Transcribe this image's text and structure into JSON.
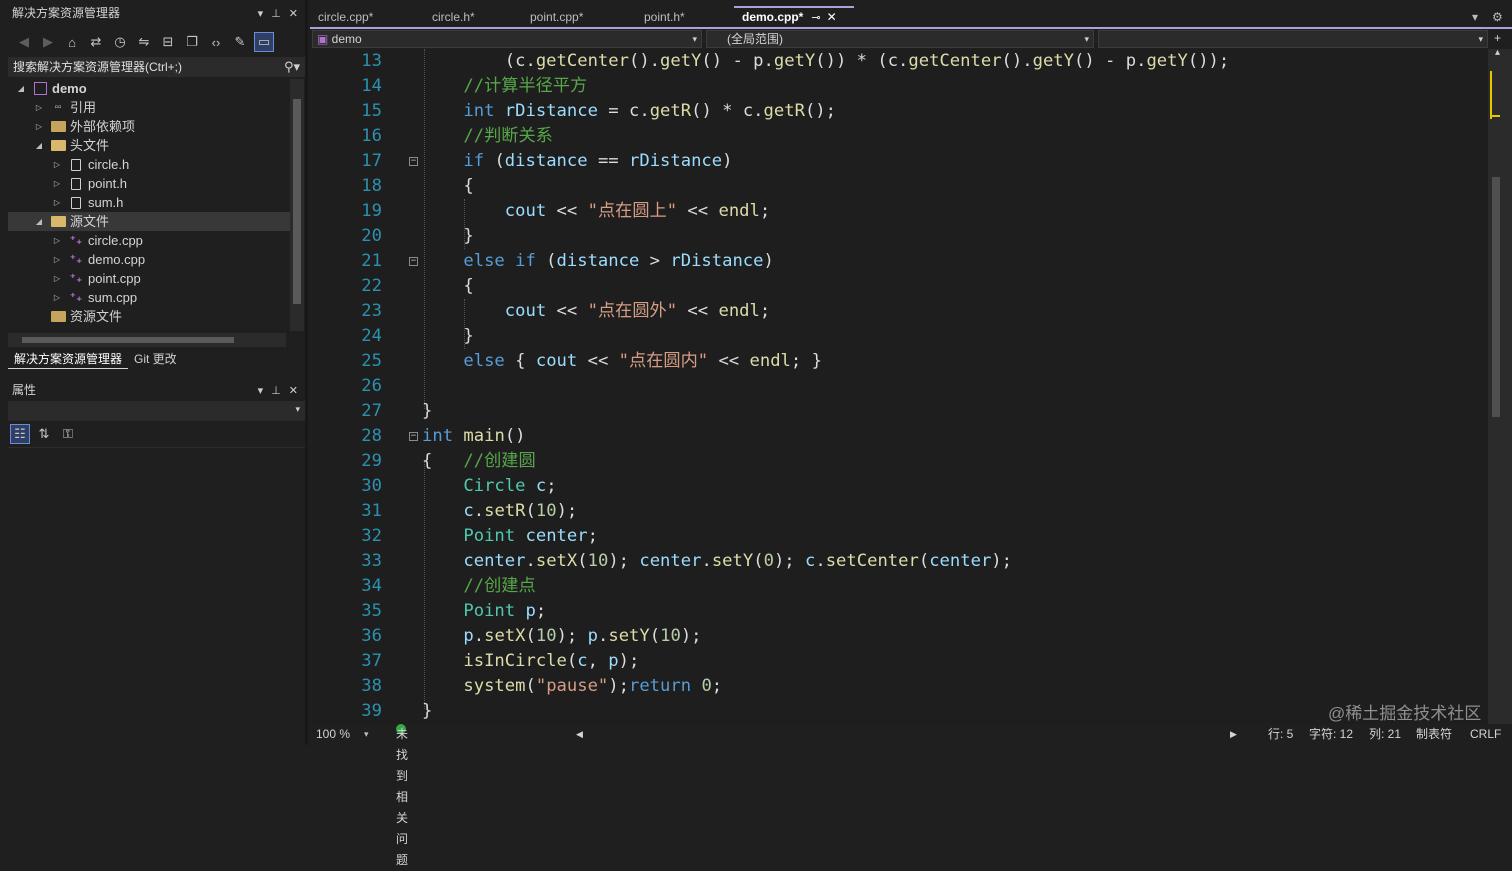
{
  "solution_explorer": {
    "title": "解决方案资源管理器",
    "search_placeholder": "搜索解决方案资源管理器(Ctrl+;)",
    "tree": [
      {
        "label": "demo",
        "icon": "project-icon",
        "level": 0,
        "expanded": true,
        "bold": true
      },
      {
        "label": "引用",
        "icon": "references-icon",
        "level": 1,
        "expanded": false
      },
      {
        "label": "外部依赖项",
        "icon": "folder-icon",
        "level": 1,
        "expanded": false
      },
      {
        "label": "头文件",
        "icon": "folder-open-icon",
        "level": 1,
        "expanded": true
      },
      {
        "label": "circle.h",
        "icon": "header-file-icon",
        "level": 2,
        "expanded": false
      },
      {
        "label": "point.h",
        "icon": "header-file-icon",
        "level": 2,
        "expanded": false
      },
      {
        "label": "sum.h",
        "icon": "header-file-icon",
        "level": 2,
        "expanded": false
      },
      {
        "label": "源文件",
        "icon": "folder-open-icon",
        "level": 1,
        "expanded": true,
        "selected": true
      },
      {
        "label": "circle.cpp",
        "icon": "cpp-file-icon",
        "level": 2,
        "expanded": false
      },
      {
        "label": "demo.cpp",
        "icon": "cpp-file-icon",
        "level": 2,
        "expanded": false
      },
      {
        "label": "point.cpp",
        "icon": "cpp-file-icon",
        "level": 2,
        "expanded": false
      },
      {
        "label": "sum.cpp",
        "icon": "cpp-file-icon",
        "level": 2,
        "expanded": false
      },
      {
        "label": "资源文件",
        "icon": "folder-icon",
        "level": 1,
        "leaf": true
      }
    ],
    "bottom_tabs": [
      "解决方案资源管理器",
      "Git 更改"
    ]
  },
  "properties": {
    "title": "属性"
  },
  "editor": {
    "tabs": [
      {
        "label": "circle.cpp*",
        "active": false
      },
      {
        "label": "circle.h*",
        "active": false
      },
      {
        "label": "point.cpp*",
        "active": false
      },
      {
        "label": "point.h*",
        "active": false
      },
      {
        "label": "demo.cpp*",
        "active": true
      }
    ],
    "nav_project": "demo",
    "nav_scope": "(全局范围)",
    "lines": [
      {
        "n": "13",
        "fold": false,
        "tokens": [
          [
            "pl",
            "        (c."
          ],
          [
            "fn",
            "getCenter"
          ],
          [
            "pl",
            "()."
          ],
          [
            "fn",
            "getY"
          ],
          [
            "pl",
            "() - p."
          ],
          [
            "fn",
            "getY"
          ],
          [
            "pl",
            "()) * (c."
          ],
          [
            "fn",
            "getCenter"
          ],
          [
            "pl",
            "()."
          ],
          [
            "fn",
            "getY"
          ],
          [
            "pl",
            "() - p."
          ],
          [
            "fn",
            "getY"
          ],
          [
            "pl",
            "());"
          ]
        ]
      },
      {
        "n": "14",
        "fold": false,
        "tokens": [
          [
            "cm",
            "    //计算半径平方"
          ]
        ]
      },
      {
        "n": "15",
        "fold": false,
        "tokens": [
          [
            "kw",
            "    int"
          ],
          [
            "pl",
            " "
          ],
          [
            "vr",
            "rDistance"
          ],
          [
            "pl",
            " = c."
          ],
          [
            "fn",
            "getR"
          ],
          [
            "pl",
            "() * c."
          ],
          [
            "fn",
            "getR"
          ],
          [
            "pl",
            "();"
          ]
        ]
      },
      {
        "n": "16",
        "fold": false,
        "tokens": [
          [
            "cm",
            "    //判断关系"
          ]
        ]
      },
      {
        "n": "17",
        "fold": true,
        "tokens": [
          [
            "kw",
            "    if"
          ],
          [
            "pl",
            " ("
          ],
          [
            "vr",
            "distance"
          ],
          [
            "pl",
            " == "
          ],
          [
            "vr",
            "rDistance"
          ],
          [
            "pl",
            ")"
          ]
        ]
      },
      {
        "n": "18",
        "fold": false,
        "tokens": [
          [
            "pl",
            "    {"
          ]
        ]
      },
      {
        "n": "19",
        "fold": false,
        "tokens": [
          [
            "pl",
            "        "
          ],
          [
            "vr",
            "cout"
          ],
          [
            "pl",
            " << "
          ],
          [
            "st",
            "\"点在圆上\""
          ],
          [
            "pl",
            " << "
          ],
          [
            "fn",
            "endl"
          ],
          [
            "pl",
            ";"
          ]
        ]
      },
      {
        "n": "20",
        "fold": false,
        "tokens": [
          [
            "pl",
            "    }"
          ]
        ]
      },
      {
        "n": "21",
        "fold": true,
        "tokens": [
          [
            "kw",
            "    else if"
          ],
          [
            "pl",
            " ("
          ],
          [
            "vr",
            "distance"
          ],
          [
            "pl",
            " > "
          ],
          [
            "vr",
            "rDistance"
          ],
          [
            "pl",
            ")"
          ]
        ]
      },
      {
        "n": "22",
        "fold": false,
        "tokens": [
          [
            "pl",
            "    {"
          ]
        ]
      },
      {
        "n": "23",
        "fold": false,
        "tokens": [
          [
            "pl",
            "        "
          ],
          [
            "vr",
            "cout"
          ],
          [
            "pl",
            " << "
          ],
          [
            "st",
            "\"点在圆外\""
          ],
          [
            "pl",
            " << "
          ],
          [
            "fn",
            "endl"
          ],
          [
            "pl",
            ";"
          ]
        ]
      },
      {
        "n": "24",
        "fold": false,
        "tokens": [
          [
            "pl",
            "    }"
          ]
        ]
      },
      {
        "n": "25",
        "fold": false,
        "tokens": [
          [
            "kw",
            "    else"
          ],
          [
            "pl",
            " { "
          ],
          [
            "vr",
            "cout"
          ],
          [
            "pl",
            " << "
          ],
          [
            "st",
            "\"点在圆内\""
          ],
          [
            "pl",
            " << "
          ],
          [
            "fn",
            "endl"
          ],
          [
            "pl",
            "; }"
          ]
        ]
      },
      {
        "n": "26",
        "fold": false,
        "tokens": []
      },
      {
        "n": "27",
        "fold": false,
        "tokens": [
          [
            "pl",
            "}"
          ]
        ]
      },
      {
        "n": "28",
        "fold": true,
        "tokens": [
          [
            "kw",
            "int"
          ],
          [
            "pl",
            " "
          ],
          [
            "fn",
            "main"
          ],
          [
            "pl",
            "()"
          ]
        ]
      },
      {
        "n": "29",
        "fold": false,
        "tokens": [
          [
            "pl",
            "{   "
          ],
          [
            "cm",
            "//创建圆"
          ]
        ]
      },
      {
        "n": "30",
        "fold": false,
        "tokens": [
          [
            "ty",
            "    Circle"
          ],
          [
            "pl",
            " "
          ],
          [
            "vr",
            "c"
          ],
          [
            "pl",
            ";"
          ]
        ]
      },
      {
        "n": "31",
        "fold": false,
        "tokens": [
          [
            "vr",
            "    c"
          ],
          [
            "pl",
            "."
          ],
          [
            "fn",
            "setR"
          ],
          [
            "pl",
            "("
          ],
          [
            "nm",
            "10"
          ],
          [
            "pl",
            ");"
          ]
        ]
      },
      {
        "n": "32",
        "fold": false,
        "tokens": [
          [
            "ty",
            "    Point"
          ],
          [
            "pl",
            " "
          ],
          [
            "vr",
            "center"
          ],
          [
            "pl",
            ";"
          ]
        ]
      },
      {
        "n": "33",
        "fold": false,
        "tokens": [
          [
            "vr",
            "    center"
          ],
          [
            "pl",
            "."
          ],
          [
            "fn",
            "setX"
          ],
          [
            "pl",
            "("
          ],
          [
            "nm",
            "10"
          ],
          [
            "pl",
            "); "
          ],
          [
            "vr",
            "center"
          ],
          [
            "pl",
            "."
          ],
          [
            "fn",
            "setY"
          ],
          [
            "pl",
            "("
          ],
          [
            "nm",
            "0"
          ],
          [
            "pl",
            "); "
          ],
          [
            "vr",
            "c"
          ],
          [
            "pl",
            "."
          ],
          [
            "fn",
            "setCenter"
          ],
          [
            "pl",
            "("
          ],
          [
            "vr",
            "center"
          ],
          [
            "pl",
            ");"
          ]
        ]
      },
      {
        "n": "34",
        "fold": false,
        "tokens": [
          [
            "cm",
            "    //创建点"
          ]
        ]
      },
      {
        "n": "35",
        "fold": false,
        "tokens": [
          [
            "ty",
            "    Point"
          ],
          [
            "pl",
            " "
          ],
          [
            "vr",
            "p"
          ],
          [
            "pl",
            ";"
          ]
        ]
      },
      {
        "n": "36",
        "fold": false,
        "tokens": [
          [
            "vr",
            "    p"
          ],
          [
            "pl",
            "."
          ],
          [
            "fn",
            "setX"
          ],
          [
            "pl",
            "("
          ],
          [
            "nm",
            "10"
          ],
          [
            "pl",
            "); "
          ],
          [
            "vr",
            "p"
          ],
          [
            "pl",
            "."
          ],
          [
            "fn",
            "setY"
          ],
          [
            "pl",
            "("
          ],
          [
            "nm",
            "10"
          ],
          [
            "pl",
            ");"
          ]
        ]
      },
      {
        "n": "37",
        "fold": false,
        "tokens": [
          [
            "fn",
            "    isInCircle"
          ],
          [
            "pl",
            "("
          ],
          [
            "vr",
            "c"
          ],
          [
            "pl",
            ", "
          ],
          [
            "vr",
            "p"
          ],
          [
            "pl",
            ");"
          ]
        ]
      },
      {
        "n": "38",
        "fold": false,
        "tokens": [
          [
            "fn",
            "    system"
          ],
          [
            "pl",
            "("
          ],
          [
            "st",
            "\"pause\""
          ],
          [
            "pl",
            ");"
          ],
          [
            "kw",
            "return"
          ],
          [
            "pl",
            " "
          ],
          [
            "nm",
            "0"
          ],
          [
            "pl",
            ";"
          ]
        ]
      },
      {
        "n": "39",
        "fold": false,
        "tokens": [
          [
            "pl",
            "}"
          ]
        ]
      }
    ]
  },
  "status": {
    "zoom": "100 %",
    "issues": "未找到相关问题",
    "line": "行: 5",
    "char": "字符: 12",
    "col": "列: 21",
    "tab_mode": "制表符",
    "eol": "CRLF"
  },
  "watermark": "@稀土掘金技术社区"
}
